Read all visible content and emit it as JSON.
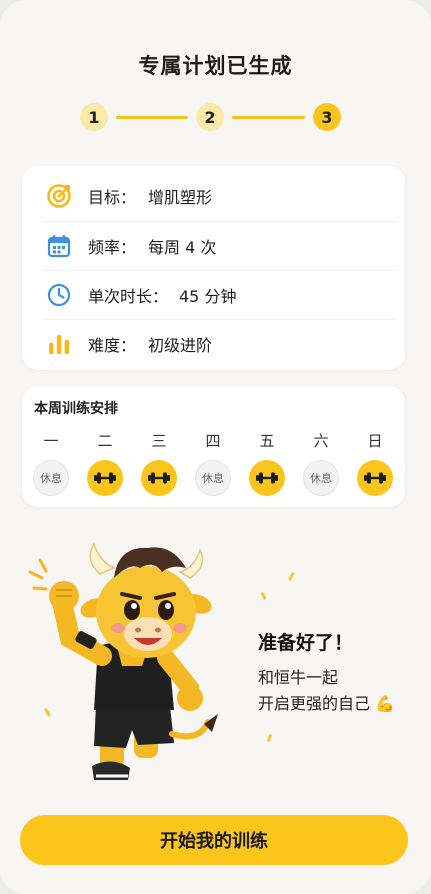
{
  "page": {
    "title": "专属计划已生成"
  },
  "stepper": {
    "steps": [
      "1",
      "2",
      "3"
    ],
    "active": 3
  },
  "plan": {
    "goal": {
      "label": "目标：",
      "value": "增肌塑形",
      "icon": "target-icon"
    },
    "freq": {
      "label": "频率：",
      "value": "每周 4 次",
      "icon": "calendar-icon"
    },
    "duration": {
      "label": "单次时长：",
      "value": "45 分钟",
      "icon": "clock-icon"
    },
    "level": {
      "label": "难度：",
      "value": "初级进阶",
      "icon": "bar-chart-icon"
    }
  },
  "week": {
    "title": "本周训练安排",
    "days": [
      {
        "label": "一",
        "type": "rest",
        "text": "休息"
      },
      {
        "label": "二",
        "type": "train",
        "icon": "dumbbell-icon"
      },
      {
        "label": "三",
        "type": "train",
        "icon": "dumbbell-icon"
      },
      {
        "label": "四",
        "type": "rest",
        "text": "休息"
      },
      {
        "label": "五",
        "type": "train",
        "icon": "dumbbell-icon"
      },
      {
        "label": "六",
        "type": "rest",
        "text": "休息"
      },
      {
        "label": "日",
        "type": "train",
        "icon": "dumbbell-icon"
      }
    ]
  },
  "promo": {
    "title": "准备好了！",
    "line1": "和恒牛一起",
    "line2": "开启更强的自己",
    "emoji": "💪"
  },
  "cta": {
    "label": "开始我的训练"
  },
  "colors": {
    "accent": "#fbc51b",
    "accent_light": "#fbe9a6",
    "background": "#f7f6f3",
    "icon_blue": "#3d8fe0"
  }
}
